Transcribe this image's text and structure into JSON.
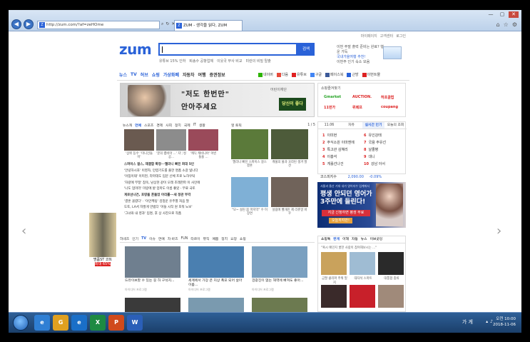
{
  "browser": {
    "address": "http://zum.com/?af=zeHOme",
    "tab_title": "ZUM - 생각을 읽다, ZUM",
    "favicon": "Z"
  },
  "header": {
    "top_links": [
      "마이페이지",
      "고객센터",
      "로그인"
    ],
    "logo": "zum",
    "search_button": "검색",
    "related": [
      "유튜브 15% 인하",
      "퇴송수 공항업체",
      "이웃국 부사 비교",
      "미란의 비밀 탈출"
    ],
    "promo_line1": "이번 주말 출력 준비는 완료? 행운 가득",
    "promo_line2": "국내가을여행 추천!",
    "promo_line3": "이번주 인기 숙소 모음"
  },
  "gnb": {
    "main": [
      "뉴스",
      "TV",
      "허브",
      "쇼핑",
      "가상화폐",
      "자동차",
      "여행",
      "증권정보"
    ],
    "services": [
      {
        "label": "네이버",
        "color": "#2db400"
      },
      {
        "label": "다음",
        "color": "#e64b3c"
      },
      {
        "label": "유튜브",
        "color": "#e02020"
      },
      {
        "label": "구글",
        "color": "#4285f4"
      },
      {
        "label": "페이스북",
        "color": "#3b5998"
      },
      {
        "label": "근방",
        "color": "#2a62d8"
      },
      {
        "label": "이번트몰",
        "color": "#d22"
      }
    ]
  },
  "banner": {
    "line1": "\"저도 한번만\"",
    "line2": "안아주세요",
    "org": "어린이재단",
    "mark": "당신이 좋다"
  },
  "shopping": {
    "header": "쇼핑즐겨찾기",
    "links": [
      {
        "label": "Gmarket",
        "color": "#2aa52a"
      },
      {
        "label": "AUCTION.",
        "color": "#d22"
      },
      {
        "label": "하프클럽",
        "color": "#d22"
      },
      {
        "label": "11번가",
        "color": "#d22"
      },
      {
        "label": "위메프",
        "color": "#d22"
      },
      {
        "label": "coupang",
        "color": "#d22"
      }
    ]
  },
  "news": {
    "tabs": [
      "뉴스캐",
      "연예",
      "스포츠",
      "경제",
      "사회",
      "정치",
      "국제",
      "IT",
      "생활"
    ],
    "thumbs": [
      {
        "caption": "'상위 등수' '미니건들이'",
        "color": "#6a5a50"
      },
      {
        "caption": "'문의 캠비아 ...' 자','성공...",
        "color": "#8c8c8c"
      },
      {
        "caption": "'캐딕 캐비니아' 아빈 들을 ...",
        "color": "#9a4a5a"
      }
    ],
    "lines": [
      "스파이스 걸스, 재결합 확정···멜라니 빠진 최대 5인",
      "'안녕하시죠' 이영자, 민령기도를 출한 명품 소갈 빛나다",
      "'아침이태' 이미현, 라마데도 입문 신체 프로 노하우탁",
      "'차량에 부정' 참옥, 남상현 같이 오래 조래한파 이 사인에",
      "'나도 엄마라' 미랑에 밭 엄마도 이름 좋았 - 무료 국토",
      "게로선나건, 호랑을 흔들었 아리를···새 정관 부각",
      "'결혼 꼴렸다' · '이안케팅' 김정운 유주별 처음 딸",
      "도토, LA서 자발게 만범다 '아들 시작 원 포워 노보'",
      "'그녀와 내 영과' 입명, 후 상 사진으로 작품"
    ]
  },
  "photo": {
    "header": "헐 토픽",
    "pager": "1 / 5",
    "items": [
      {
        "caption": "멜라니 빠진 스파이스 걸스 결혼",
        "color": "#5b7a3a"
      },
      {
        "caption": "캐울의 불과 꼬라린 생겨 발견",
        "color": "#4d5b3a"
      },
      {
        "caption": "\"모~ 설린 몸 마지막\" 수 이 장면",
        "color": "#7fb0d6"
      },
      {
        "caption": "설림에 빨개진 제 리츄얼 바꾸",
        "color": "#70635a"
      }
    ]
  },
  "rank": {
    "tabs": [
      "11.06",
      "자유",
      "실시간 인기",
      "오늘의 조회"
    ],
    "left": [
      "이미현",
      "주식소원 이마젠에",
      "특고관 김혜리",
      "이홍석",
      "게롤선나건"
    ],
    "right": [
      "유인강태",
      "국용 주유선",
      "날줄병",
      "대니",
      "강남 아서"
    ],
    "stock_label": "코스피지수",
    "stock_value": "2,090.00",
    "stock_change": "-0.09%"
  },
  "ad2": {
    "top": "서울과 울산 기대 내가 영어지수 업계에서",
    "main1": "평생 안되던 영어가",
    "main2": "3주만에 들린다!",
    "cta": "지금 신청하면 평생 무료",
    "cta2": "오늘까지만!"
  },
  "lower": {
    "tabs": [
      "하네즈",
      "인기",
      "TV",
      "이슈",
      "연예",
      "차·바즈",
      "FUN",
      "타르이",
      "뮤직",
      "예쁨",
      "정치",
      "요정",
      "쇼핑"
    ],
    "active": "TV",
    "items": [
      {
        "caption": "드라이브할 수 있는 길 하 구석지...",
        "source": "아이디어 프로그램",
        "color": "#6f7f8f"
      },
      {
        "caption": "세계에서 가장 큰 지상 폭포 되어 살아 이름...",
        "source": "아이디어 프로그램",
        "color": "#4a7fb0"
      },
      {
        "caption": "검광진이 없는 해역에 빠져도 좋아...",
        "source": "아이디어 프로그램",
        "color": "#7aa0c0"
      },
      {
        "caption": "",
        "source": "",
        "color": "#3a3a3a"
      },
      {
        "caption": "",
        "source": "",
        "color": "#7a9aaf"
      },
      {
        "caption": "",
        "source": "",
        "color": "#6c7a50"
      }
    ]
  },
  "shop2": {
    "tabs": [
      "쇼핑톡",
      "란게",
      "이해",
      "자동",
      "뉴스",
      "이브곳딩"
    ],
    "note": "\"혹시 예민지 쿨한 사람이 참여해보시는 ...\"",
    "items": [
      {
        "caption": "금팔 클리파 주위 밑지",
        "color": "#c9a25c"
      },
      {
        "caption": "대자석 스마트",
        "color": "#9fbcd3"
      },
      {
        "caption": "대통합 종류",
        "color": "#2a2a2a"
      }
    ]
  },
  "sidead": {
    "label": "명품ST 코트",
    "discount": "최대 65%"
  },
  "arrows": {
    "left": "‹",
    "right": "›"
  },
  "taskbar": {
    "apps": [
      {
        "label": "e",
        "color": "#2f7fd4"
      },
      {
        "label": "G",
        "color": "#e0a020"
      },
      {
        "label": "e",
        "color": "#1a6fc8"
      },
      {
        "label": "X",
        "color": "#1d8a42"
      },
      {
        "label": "P",
        "color": "#d04a1c"
      },
      {
        "label": "W",
        "color": "#2b5fb8"
      }
    ],
    "lang": "가 게 ",
    "time": "오전 10:00",
    "date": "2018-11-06"
  }
}
